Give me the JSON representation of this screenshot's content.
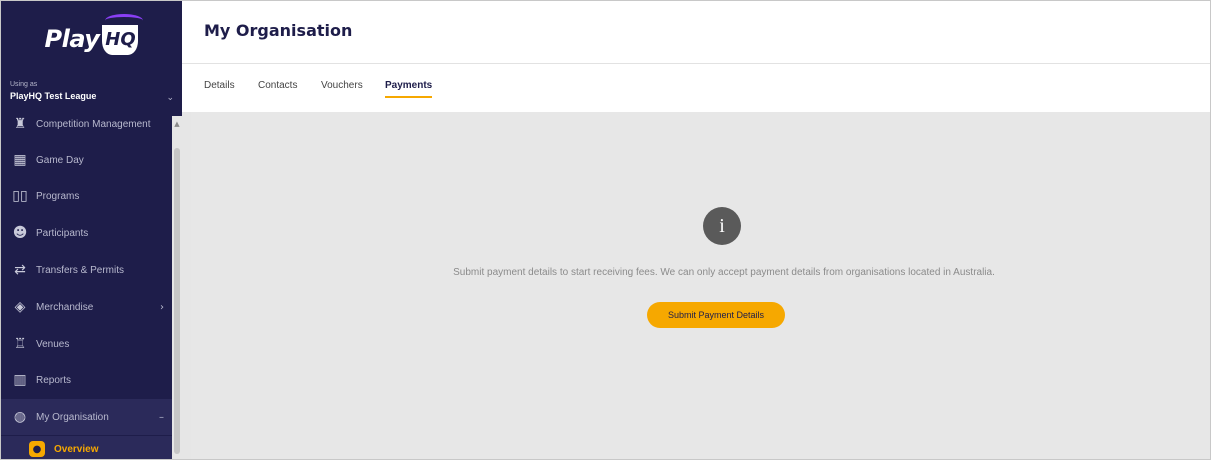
{
  "app": {
    "logo_text": "Play",
    "logo_badge": "HQ"
  },
  "org_switcher": {
    "using_as_label": "Using as",
    "org_name": "PlayHQ Test League"
  },
  "sidebar": {
    "items": [
      {
        "label": "Competition Management",
        "icon": "trophy-icon"
      },
      {
        "label": "Game Day",
        "icon": "scoreboard-icon"
      },
      {
        "label": "Programs",
        "icon": "book-icon"
      },
      {
        "label": "Participants",
        "icon": "people-icon"
      },
      {
        "label": "Transfers & Permits",
        "icon": "transfer-icon"
      },
      {
        "label": "Merchandise",
        "icon": "shirt-icon"
      },
      {
        "label": "Venues",
        "icon": "stadium-icon"
      },
      {
        "label": "Reports",
        "icon": "report-icon"
      },
      {
        "label": "My Organisation",
        "icon": "globe-icon"
      }
    ],
    "sub_items": [
      {
        "label": "Overview",
        "icon": "location-pin-icon"
      }
    ]
  },
  "header": {
    "title": "My Organisation"
  },
  "tabs": [
    {
      "label": "Details"
    },
    {
      "label": "Contacts"
    },
    {
      "label": "Vouchers"
    },
    {
      "label": "Payments",
      "active": true
    }
  ],
  "content": {
    "message": "Submit payment details to start receiving fees. We can only accept payment details from organisations located in Australia.",
    "submit_label": "Submit Payment Details"
  },
  "colors": {
    "sidebar_bg": "#1e1d4a",
    "accent": "#f6a800",
    "content_bg": "#e7e7e7"
  }
}
